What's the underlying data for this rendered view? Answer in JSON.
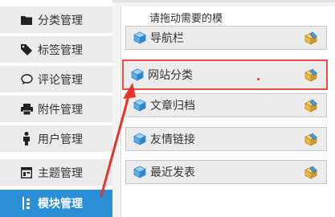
{
  "sidebar": {
    "items": [
      {
        "label": "分类管理",
        "icon": "folder-icon"
      },
      {
        "label": "标签管理",
        "icon": "tag-icon"
      },
      {
        "label": "评论管理",
        "icon": "comment-icon"
      },
      {
        "label": "附件管理",
        "icon": "attachment-icon"
      },
      {
        "label": "用户管理",
        "icon": "user-icon"
      },
      {
        "label": "主题管理",
        "icon": "theme-icon"
      },
      {
        "label": "模块管理",
        "icon": "module-icon",
        "active": true
      }
    ]
  },
  "main": {
    "hint": "请拖动需要的模",
    "modules": [
      {
        "label": "导航栏"
      },
      {
        "label": "网站分类",
        "highlighted": true
      },
      {
        "label": "文章归档"
      },
      {
        "label": "友情链接"
      },
      {
        "label": "最近发表"
      }
    ]
  },
  "colors": {
    "active_nav": "#2b8fd6",
    "highlight_border": "#f04b43",
    "annotation": "#e8332b"
  }
}
